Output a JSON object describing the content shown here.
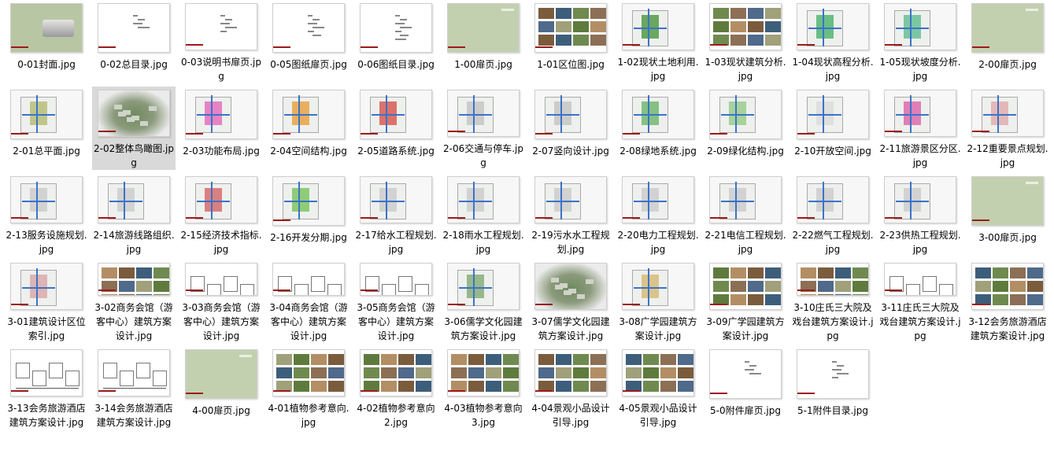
{
  "files": [
    {
      "name": "0-01封面.jpg",
      "type": "cover"
    },
    {
      "name": "0-02总目录.jpg",
      "type": "text"
    },
    {
      "name": "0-03说明书扉页.jpg",
      "type": "text"
    },
    {
      "name": "0-05图纸扉页.jpg",
      "type": "text"
    },
    {
      "name": "0-06图纸目录.jpg",
      "type": "text"
    },
    {
      "name": "1-00扉页.jpg",
      "type": "green"
    },
    {
      "name": "1-01区位图.jpg",
      "type": "photos"
    },
    {
      "name": "1-02现状土地利用.jpg",
      "type": "map",
      "accent": "#3f8f2e"
    },
    {
      "name": "1-03现状建筑分析.jpg",
      "type": "photos"
    },
    {
      "name": "1-04现状高程分析.jpg",
      "type": "map",
      "accent": "#3cae62"
    },
    {
      "name": "1-05现状坡度分析.jpg",
      "type": "map",
      "accent": "#56b98a"
    },
    {
      "name": "2-00扉页.jpg",
      "type": "green"
    },
    {
      "name": "2-01总平面.jpg",
      "type": "map",
      "accent": "#b0b86a"
    },
    {
      "name": "2-02整体鸟瞰图.jpg",
      "type": "aerial",
      "selected": true
    },
    {
      "name": "2-03功能布局.jpg",
      "type": "map",
      "accent": "#e35fb7"
    },
    {
      "name": "2-04空间结构.jpg",
      "type": "map",
      "accent": "#e79a2f"
    },
    {
      "name": "2-05道路系统.jpg",
      "type": "map",
      "accent": "#d4483f"
    },
    {
      "name": "2-06交通与停车.jpg",
      "type": "map",
      "accent": "#c0c0c0"
    },
    {
      "name": "2-07竖向设计.jpg",
      "type": "map",
      "accent": "#c0c0c0"
    },
    {
      "name": "2-08绿地系统.jpg",
      "type": "map",
      "accent": "#62b25d"
    },
    {
      "name": "2-09绿化结构.jpg",
      "type": "map",
      "accent": "#8fc87d"
    },
    {
      "name": "2-10开放空间.jpg",
      "type": "map",
      "accent": "#d9d9d9"
    },
    {
      "name": "2-11旅游景区分区.jpg",
      "type": "map",
      "accent": "#d85aa4"
    },
    {
      "name": "2-12重要景点规划.jpg",
      "type": "map",
      "accent": "#e0a5a5"
    },
    {
      "name": "2-13服务设施规划.jpg",
      "type": "map",
      "accent": "#c8c8c8"
    },
    {
      "name": "2-14旅游线路组织.jpg",
      "type": "map",
      "accent": "#c8c8c8"
    },
    {
      "name": "2-15经济技术指标.jpg",
      "type": "map",
      "accent": "#d35b5b"
    },
    {
      "name": "2-16开发分期.jpg",
      "type": "map",
      "accent": "#6fc04f"
    },
    {
      "name": "2-17给水工程规划.jpg",
      "type": "map",
      "accent": "#c8c8c8"
    },
    {
      "name": "2-18雨水工程规划.jpg",
      "type": "map",
      "accent": "#c8c8c8"
    },
    {
      "name": "2-19污水水工程规划.jpg",
      "type": "map",
      "accent": "#c8c8c8"
    },
    {
      "name": "2-20电力工程规划.jpg",
      "type": "map",
      "accent": "#c8c8c8"
    },
    {
      "name": "2-21电信工程规划.jpg",
      "type": "map",
      "accent": "#c8c8c8"
    },
    {
      "name": "2-22燃气工程规划.jpg",
      "type": "map",
      "accent": "#c8c8c8"
    },
    {
      "name": "2-23供热工程规划.jpg",
      "type": "map",
      "accent": "#c8c8c8"
    },
    {
      "name": "3-00扉页.jpg",
      "type": "green"
    },
    {
      "name": "3-01建筑设计区位索引.jpg",
      "type": "map",
      "accent": "#d8a0a0"
    },
    {
      "name": "3-02商务会馆（游客中心）建筑方案设计.jpg",
      "type": "photos"
    },
    {
      "name": "3-03商务会馆（游客中心）建筑方案设计.jpg",
      "type": "draw"
    },
    {
      "name": "3-04商务会馆（游客中心）建筑方案设计.jpg",
      "type": "draw"
    },
    {
      "name": "3-05商务会馆（游客中心）建筑方案设计.jpg",
      "type": "draw"
    },
    {
      "name": "3-06儒学文化园建筑方案设计.jpg",
      "type": "map",
      "accent": "#7aa66a"
    },
    {
      "name": "3-07儒学文化园建筑方案设计.jpg",
      "type": "aerial"
    },
    {
      "name": "3-08广学园建筑方案设计.jpg",
      "type": "map",
      "accent": "#d4b66a"
    },
    {
      "name": "3-09广学园建筑方案设计.jpg",
      "type": "photos"
    },
    {
      "name": "3-10庄氏三大院及戏台建筑方案设计.jpg",
      "type": "photos"
    },
    {
      "name": "3-11庄氏三大院及戏台建筑方案设计.jpg",
      "type": "draw"
    },
    {
      "name": "3-12会务旅游酒店建筑方案设计.jpg",
      "type": "photos"
    },
    {
      "name": "3-13会务旅游酒店建筑方案设计.jpg",
      "type": "draw"
    },
    {
      "name": "3-14会务旅游酒店建筑方案设计.jpg",
      "type": "draw"
    },
    {
      "name": "4-00扉页.jpg",
      "type": "green"
    },
    {
      "name": "4-01植物参考意向.jpg",
      "type": "photos"
    },
    {
      "name": "4-02植物参考意向2.jpg",
      "type": "photos"
    },
    {
      "name": "4-03植物参考意向3.jpg",
      "type": "photos"
    },
    {
      "name": "4-04景观小品设计引导.jpg",
      "type": "photos"
    },
    {
      "name": "4-05景观小品设计引导.jpg",
      "type": "photos"
    },
    {
      "name": "5-0附件扉页.jpg",
      "type": "text"
    },
    {
      "name": "5-1附件目录.jpg",
      "type": "text"
    }
  ]
}
